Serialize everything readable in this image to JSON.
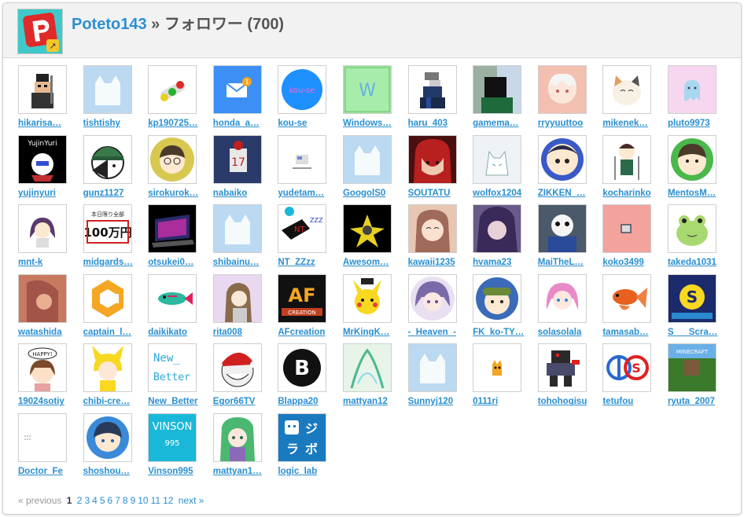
{
  "header": {
    "owner": "Poteto143",
    "separator": "»",
    "section": "フォロワー",
    "count": "(700)"
  },
  "followers": [
    {
      "name": "hikarisa…",
      "icon": "pixel-samurai",
      "bg": "#ffffff"
    },
    {
      "name": "tishtishy",
      "icon": "default-cat",
      "bg": "#bcd9f2"
    },
    {
      "name": "kp190725…",
      "icon": "traffic-light",
      "bg": "#ffffff"
    },
    {
      "name": "honda_a…",
      "icon": "mail-badge",
      "bg": "#3b8ff5"
    },
    {
      "name": "kou-se",
      "icon": "blue-circle",
      "bg": "#ffffff"
    },
    {
      "name": "Windows…",
      "icon": "green-w",
      "bg": "#9be49b"
    },
    {
      "name": "haru_403",
      "icon": "pixel-knight",
      "bg": "#ffffff"
    },
    {
      "name": "gamema…",
      "icon": "dark-figure",
      "bg": "#9ab0a0"
    },
    {
      "name": "rryyuuttoo",
      "icon": "anime-white-hair",
      "bg": "#f3c0b0"
    },
    {
      "name": "mikenek…",
      "icon": "calico-cat",
      "bg": "#ffffff"
    },
    {
      "name": "pluto9973",
      "icon": "ghost",
      "bg": "#f7d6ef"
    },
    {
      "name": "yujinyuri",
      "icon": "yujin-text",
      "bg": "#000000"
    },
    {
      "name": "gunz1127",
      "icon": "beanie-face",
      "bg": "#ffffff"
    },
    {
      "name": "sirokurok…",
      "icon": "glasses-boy",
      "bg": "#ffffff"
    },
    {
      "name": "nabaiko",
      "icon": "baseball",
      "bg": "#3a4a7a"
    },
    {
      "name": "yudetam…",
      "icon": "small-doc",
      "bg": "#ffffff"
    },
    {
      "name": "GoogolS0",
      "icon": "default-cat",
      "bg": "#bcd9f2"
    },
    {
      "name": "SOUTATU",
      "icon": "red-hair",
      "bg": "#4a1010"
    },
    {
      "name": "wolfox1204",
      "icon": "wolf-sketch",
      "bg": "#eef2f6"
    },
    {
      "name": "ZIKKEN_…",
      "icon": "zikken",
      "bg": "#ffffff"
    },
    {
      "name": "kocharinko",
      "icon": "chibi-swords",
      "bg": "#ffffff"
    },
    {
      "name": "MentosM…",
      "icon": "green-circle-boy",
      "bg": "#ffffff"
    },
    {
      "name": "mnt-k",
      "icon": "purple-girl",
      "bg": "#ffffff"
    },
    {
      "name": "midgards…",
      "icon": "yen-text",
      "bg": "#ffffff"
    },
    {
      "name": "otsukei0…",
      "icon": "laptop",
      "bg": "#000000"
    },
    {
      "name": "shibainu…",
      "icon": "default-cat",
      "bg": "#bcd9f2"
    },
    {
      "name": "NT_ZZzz",
      "icon": "nt-zzz",
      "bg": "#ffffff"
    },
    {
      "name": "Awesom…",
      "icon": "yellow-rays",
      "bg": "#000000"
    },
    {
      "name": "kawaii1235",
      "icon": "smile-girl",
      "bg": "#e7c7b4"
    },
    {
      "name": "hvama23",
      "icon": "purple-hair",
      "bg": "#6a5a8a"
    },
    {
      "name": "MaiTheL…",
      "icon": "sans",
      "bg": "#4a5a6a"
    },
    {
      "name": "koko3499",
      "icon": "pink-box",
      "bg": "#f3a29c"
    },
    {
      "name": "takeda1031",
      "icon": "frog",
      "bg": "#ffffff"
    },
    {
      "name": "watashida",
      "icon": "lena",
      "bg": "#c77a60"
    },
    {
      "name": "captain_l…",
      "icon": "orange-c",
      "bg": "#ffffff"
    },
    {
      "name": "daikikato",
      "icon": "fish-sprite",
      "bg": "#ffffff"
    },
    {
      "name": "rita008",
      "icon": "sketch-girl",
      "bg": "#e9d9f0"
    },
    {
      "name": "AFcreation",
      "icon": "af-logo",
      "bg": "#111111"
    },
    {
      "name": "MrKingK…",
      "icon": "pikachu",
      "bg": "#ffffff"
    },
    {
      "name": "-_Heaven_-",
      "icon": "anime-purple",
      "bg": "#ffffff"
    },
    {
      "name": "FK_ko-TY…",
      "icon": "hat-boy",
      "bg": "#ffffff"
    },
    {
      "name": "solasolala",
      "icon": "pink-hair-girl",
      "bg": "#ffffff"
    },
    {
      "name": "tamasab…",
      "icon": "goldfish",
      "bg": "#ffffff"
    },
    {
      "name": "S___Scra…",
      "icon": "s-badge",
      "bg": "#1a2a6a"
    },
    {
      "name": "19024sotiy",
      "icon": "happy-girl",
      "bg": "#ffffff"
    },
    {
      "name": "chibi-cre…",
      "icon": "pikachu-girl",
      "bg": "#ffffff"
    },
    {
      "name": "New_Better",
      "icon": "new-better",
      "bg": "#ffffff"
    },
    {
      "name": "Egor66TV",
      "icon": "troll",
      "bg": "#ffffff"
    },
    {
      "name": "Blappa20",
      "icon": "b-logo",
      "bg": "#ffffff"
    },
    {
      "name": "mattyan12",
      "icon": "green-sketch",
      "bg": "#e8f4e8"
    },
    {
      "name": "Sunnyj120",
      "icon": "default-cat",
      "bg": "#bcd9f2"
    },
    {
      "name": "0111ri",
      "icon": "scratch-cat",
      "bg": "#ffffff"
    },
    {
      "name": "tohohogisu",
      "icon": "pixel-monster",
      "bg": "#ffffff"
    },
    {
      "name": "tetufou",
      "icon": "os-logo",
      "bg": "#ffffff"
    },
    {
      "name": "ryuta_2007",
      "icon": "minecraft",
      "bg": "#3a6a2a"
    },
    {
      "name": "Doctor_Fe",
      "icon": "blank-dots",
      "bg": "#ffffff"
    },
    {
      "name": "shoshou…",
      "icon": "blue-boy",
      "bg": "#ffffff"
    },
    {
      "name": "Vinson995",
      "icon": "vinson",
      "bg": "#1ab8d8"
    },
    {
      "name": "mattyan1…",
      "icon": "green-hair-girl",
      "bg": "#ffffff"
    },
    {
      "name": "logic_lab",
      "icon": "logic-lab",
      "bg": "#1a7ac0"
    }
  ],
  "pager": {
    "previous": "« previous",
    "current": "1",
    "pages": [
      "2",
      "3",
      "4",
      "5",
      "6",
      "7",
      "8",
      "9",
      "10",
      "11",
      "12"
    ],
    "next": "next »"
  },
  "colors": {
    "link": "#2a8fd0",
    "header_bg": "#f2f2f2"
  }
}
